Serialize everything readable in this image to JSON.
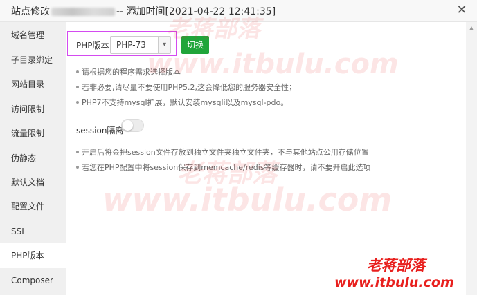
{
  "title": {
    "prefix": "站点修改",
    "suffix": "-- 添加时间[2021-04-22 12:41:35]"
  },
  "close_symbol": "✕",
  "sidebar": {
    "items": [
      {
        "label": "域名管理"
      },
      {
        "label": "子目录绑定"
      },
      {
        "label": "网站目录"
      },
      {
        "label": "访问限制"
      },
      {
        "label": "流量限制"
      },
      {
        "label": "伪静态"
      },
      {
        "label": "默认文档"
      },
      {
        "label": "配置文件"
      },
      {
        "label": "SSL"
      },
      {
        "label": "PHP版本"
      },
      {
        "label": "Composer"
      }
    ],
    "active": "PHP版本"
  },
  "php": {
    "label": "PHP版本",
    "selected": "PHP-73",
    "switch_label": "切换"
  },
  "tips": [
    "请根据您的程序需求选择版本",
    "若非必要,请尽量不要使用PHP5.2,这会降低您的服务器安全性；",
    "PHP7不支持mysql扩展，默认安装mysqli以及mysql-pdo。"
  ],
  "session": {
    "label": "session隔离",
    "enabled": false
  },
  "session_tips": [
    "开启后将会把session文件存放到独立文件夹独立文件夹，不与其他站点公用存储位置",
    "若您在PHP配置中将session保存到memcache/redis等缓存器时，请不要开启此选项"
  ],
  "watermarks": {
    "brand": "老蒋部落",
    "url": "www.itbulu.com"
  },
  "colors": {
    "accent_green": "#20a53a",
    "highlight_border": "#d44bf0",
    "watermark_red": "#e8201e"
  }
}
